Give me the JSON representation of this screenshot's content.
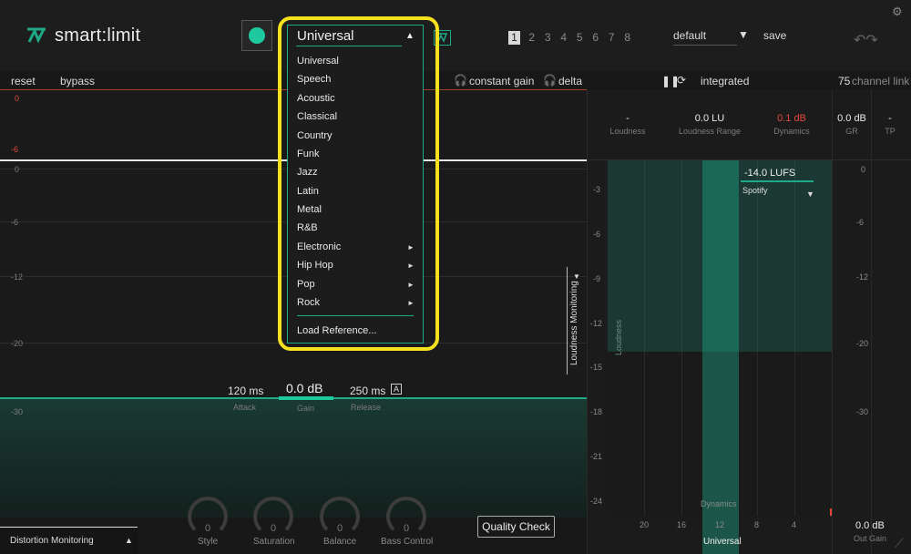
{
  "app": {
    "name": "smart:limit"
  },
  "header": {
    "preset_slots": [
      "1",
      "2",
      "3",
      "4",
      "5",
      "6",
      "7",
      "8"
    ],
    "preset_name": "default",
    "save_label": "save"
  },
  "toolbar_left": {
    "reset": "reset",
    "bypass": "bypass",
    "constant_gain": "constant gain",
    "delta": "delta"
  },
  "toolbar_right": {
    "mode": "integrated",
    "channel_link_value": "75",
    "channel_link_label": "channel link"
  },
  "left_scale": {
    "top_zero": "0",
    "top_minus6": "-6",
    "s0": "0",
    "s6": "-6",
    "s12": "-12",
    "s20": "-20",
    "s30": "-30"
  },
  "params": {
    "attack_value": "120 ms",
    "attack_label": "Attack",
    "gain_value": "0.0 dB",
    "gain_label": "Gain",
    "release_value": "250 ms",
    "release_label": "Release",
    "auto_label": "A"
  },
  "loudness_monitoring_label": "Loudness Monitoring",
  "distortion_monitoring_label": "Distortion Monitoring",
  "knobs": [
    {
      "value": "0",
      "label": "Style"
    },
    {
      "value": "0",
      "label": "Saturation"
    },
    {
      "value": "0",
      "label": "Balance"
    },
    {
      "value": "0",
      "label": "Bass Control"
    }
  ],
  "quality_check_label": "Quality Check",
  "meters": {
    "loudness_value": "-",
    "loudness_label": "Loudness",
    "range_value": "0.0 LU",
    "range_label": "Loudness Range",
    "dynamics_value": "0.1 dB",
    "dynamics_label": "Dynamics",
    "gr_value": "0.0 dB",
    "gr_label": "GR",
    "tp_value": "-",
    "tp_label": "TP"
  },
  "graph": {
    "y_labels": [
      "-3",
      "-6",
      "-9",
      "-12",
      "-15",
      "-18",
      "-21",
      "-24"
    ],
    "x_labels": [
      "20",
      "16",
      "12",
      "8",
      "4"
    ],
    "loudness_axis": "Loudness",
    "dynamics_axis": "Dynamics",
    "target_lufs": "-14.0 LUFS",
    "target_platform": "Spotify",
    "genre_label": "Universal",
    "gr_scale": [
      "0",
      "-6",
      "-12",
      "-20",
      "-30"
    ],
    "out_gain_value": "0.0 dB",
    "out_gain_label": "Out Gain"
  },
  "dropdown": {
    "selected": "Universal",
    "items": [
      "Universal",
      "Speech",
      "Acoustic",
      "Classical",
      "Country",
      "Funk",
      "Jazz",
      "Latin",
      "Metal",
      "R&B"
    ],
    "submenus": [
      "Electronic",
      "Hip Hop",
      "Pop",
      "Rock"
    ],
    "load_reference": "Load Reference..."
  },
  "colors": {
    "accent": "#1ea987",
    "highlight": "#f5e11e",
    "warning": "#e0493a"
  }
}
